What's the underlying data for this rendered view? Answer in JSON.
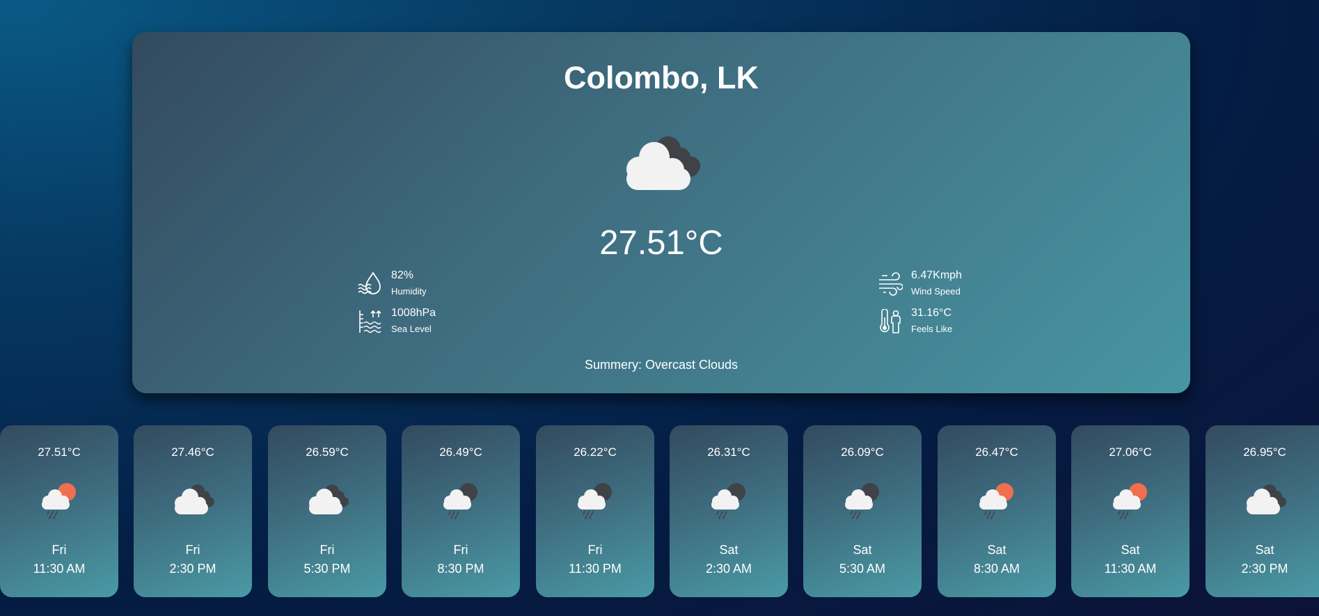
{
  "current": {
    "city": "Colombo, LK",
    "icon": "overcast-clouds-icon",
    "temperature": "27.51°C",
    "humidity": {
      "value": "82%",
      "label": "Humidity"
    },
    "wind_speed": {
      "value": "6.47Kmph",
      "label": "Wind Speed"
    },
    "sea_level": {
      "value": "1008hPa",
      "label": "Sea Level"
    },
    "feels_like": {
      "value": "31.16°C",
      "label": "Feels Like"
    },
    "summary": "Summery: Overcast Clouds"
  },
  "forecast": [
    {
      "temp": "27.51°C",
      "icon": "cloud-rain-sun-icon",
      "day": "Fri",
      "time": "11:30 AM"
    },
    {
      "temp": "27.46°C",
      "icon": "overcast-clouds-icon",
      "day": "Fri",
      "time": "2:30 PM"
    },
    {
      "temp": "26.59°C",
      "icon": "overcast-clouds-icon",
      "day": "Fri",
      "time": "5:30 PM"
    },
    {
      "temp": "26.49°C",
      "icon": "cloud-rain-moon-icon",
      "day": "Fri",
      "time": "8:30 PM"
    },
    {
      "temp": "26.22°C",
      "icon": "cloud-rain-moon-icon",
      "day": "Fri",
      "time": "11:30 PM"
    },
    {
      "temp": "26.31°C",
      "icon": "cloud-rain-moon-icon",
      "day": "Sat",
      "time": "2:30 AM"
    },
    {
      "temp": "26.09°C",
      "icon": "cloud-rain-moon-icon",
      "day": "Sat",
      "time": "5:30 AM"
    },
    {
      "temp": "26.47°C",
      "icon": "cloud-rain-sun-icon",
      "day": "Sat",
      "time": "8:30 AM"
    },
    {
      "temp": "27.06°C",
      "icon": "cloud-rain-sun-icon",
      "day": "Sat",
      "time": "11:30 AM"
    },
    {
      "temp": "26.95°C",
      "icon": "overcast-clouds-icon",
      "day": "Sat",
      "time": "2:30 PM"
    }
  ],
  "colors": {
    "sun": "#ef6f4f",
    "dark_cloud": "#3f4247",
    "light_cloud": "#f2f2f2",
    "rain": "#444a52"
  }
}
